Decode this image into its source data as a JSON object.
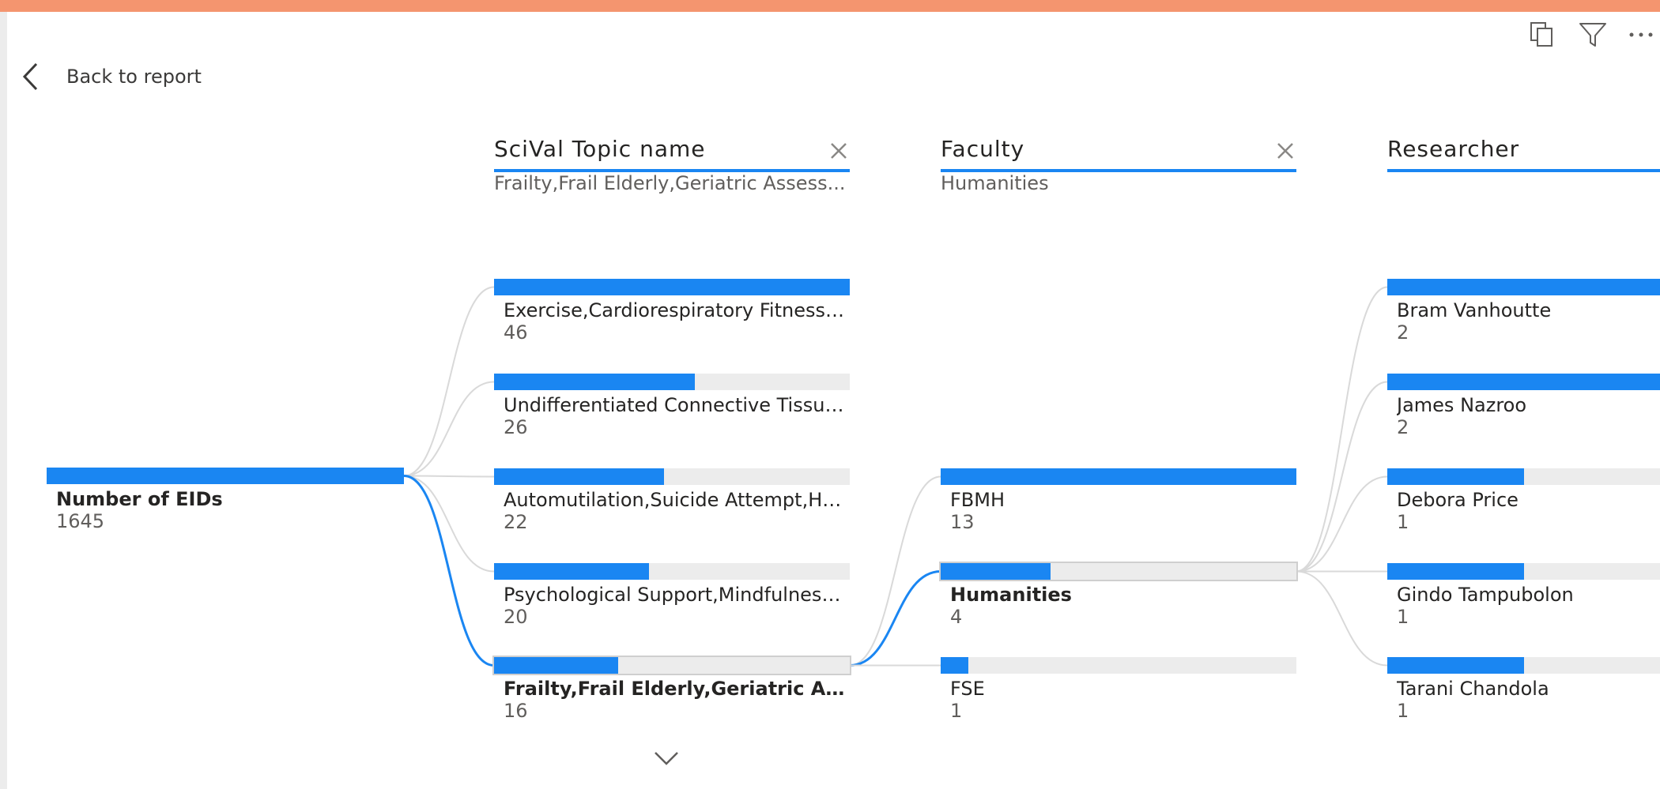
{
  "toolbar": {
    "copy_icon": "copy-visual-icon",
    "filter_icon": "filter-icon",
    "more_icon": "more-options-icon"
  },
  "nav": {
    "back_label": "Back to report"
  },
  "colors": {
    "accent": "#1a86f2",
    "track": "#ececec",
    "top_bar": "#f4956f",
    "link": "#d9d9d9"
  },
  "root": {
    "label": "Number of EIDs",
    "value": "1645",
    "fill": 1.0
  },
  "columns": [
    {
      "title": "SciVal Topic name",
      "selection": "Frailty,Frail Elderly,Geriatric Assess...",
      "clearable": true,
      "nodes": [
        {
          "label": "Exercise,Cardiorespiratory Fitness,S...",
          "value": "46",
          "fill": 1.0,
          "selected": false
        },
        {
          "label": "Undifferentiated Connective Tissue...",
          "value": "26",
          "fill": 0.565,
          "selected": false
        },
        {
          "label": "Automutilation,Suicide Attempt,Ha...",
          "value": "22",
          "fill": 0.478,
          "selected": false
        },
        {
          "label": "Psychological Support,Mindfulness...",
          "value": "20",
          "fill": 0.435,
          "selected": false
        },
        {
          "label": "Frailty,Frail Elderly,Geriatric Asse...",
          "value": "16",
          "fill": 0.348,
          "selected": true
        }
      ]
    },
    {
      "title": "Faculty",
      "selection": "Humanities",
      "clearable": true,
      "nodes": [
        {
          "label": "FBMH",
          "value": "13",
          "fill": 1.0,
          "selected": false
        },
        {
          "label": "Humanities",
          "value": "4",
          "fill": 0.308,
          "selected": true
        },
        {
          "label": "FSE",
          "value": "1",
          "fill": 0.077,
          "selected": false
        }
      ]
    },
    {
      "title": "Researcher",
      "selection": "",
      "clearable": false,
      "nodes": [
        {
          "label": "Bram Vanhoutte",
          "value": "2",
          "fill": 1.0,
          "selected": false
        },
        {
          "label": "James Nazroo",
          "value": "2",
          "fill": 1.0,
          "selected": false
        },
        {
          "label": "Debora Price",
          "value": "1",
          "fill": 0.5,
          "selected": false
        },
        {
          "label": "Gindo Tampubolon",
          "value": "1",
          "fill": 0.5,
          "selected": false
        },
        {
          "label": "Tarani Chandola",
          "value": "1",
          "fill": 0.5,
          "selected": false
        }
      ]
    }
  ],
  "more_icon_label": "expand-more-icon"
}
